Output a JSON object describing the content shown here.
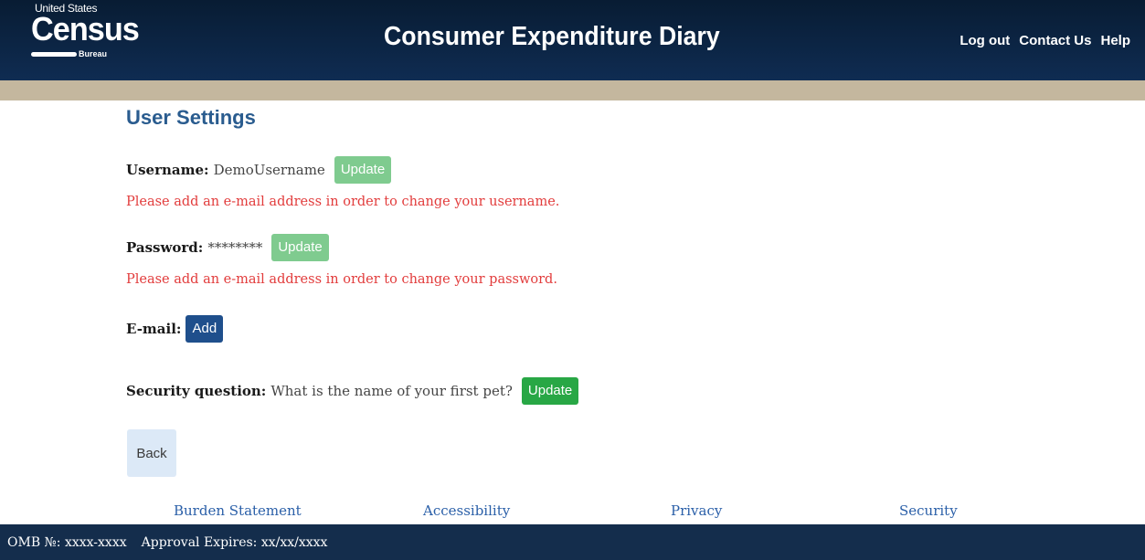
{
  "header": {
    "logo": {
      "top_text": "United States",
      "main_text": "Census",
      "sub_text": "Bureau"
    },
    "title": "Consumer Expenditure Diary",
    "links": {
      "logout": "Log out",
      "contact": "Contact Us",
      "help": "Help"
    }
  },
  "main": {
    "page_title": "User Settings",
    "username": {
      "label": "Username:",
      "value": "DemoUsername",
      "button": "Update",
      "error": "Please add an e-mail address in order to change your username."
    },
    "password": {
      "label": "Password:",
      "value": "********",
      "button": "Update",
      "error": "Please add an e-mail address in order to change your password."
    },
    "email": {
      "label": "E-mail:",
      "button": "Add"
    },
    "security": {
      "label": "Security question:",
      "value": "What is the name of your first pet?",
      "button": "Update"
    },
    "back_button": "Back"
  },
  "footer": {
    "links": {
      "burden": "Burden Statement",
      "accessibility": "Accessibility",
      "privacy": "Privacy",
      "security": "Security"
    },
    "omb": "OMB №: xxxx-xxxx",
    "approval": "Approval Expires: xx/xx/xxxx"
  },
  "colors": {
    "header_bg": "#0f2c52",
    "tan_bar": "#c4b79e",
    "title_blue": "#2a5c8f",
    "error_red": "#e23c3c",
    "update_green": "#28a745",
    "update_green_disabled": "#7fcb8f",
    "add_blue": "#1f4f8c",
    "back_bg": "#dce9f7",
    "footer_bg": "#142d4c"
  }
}
